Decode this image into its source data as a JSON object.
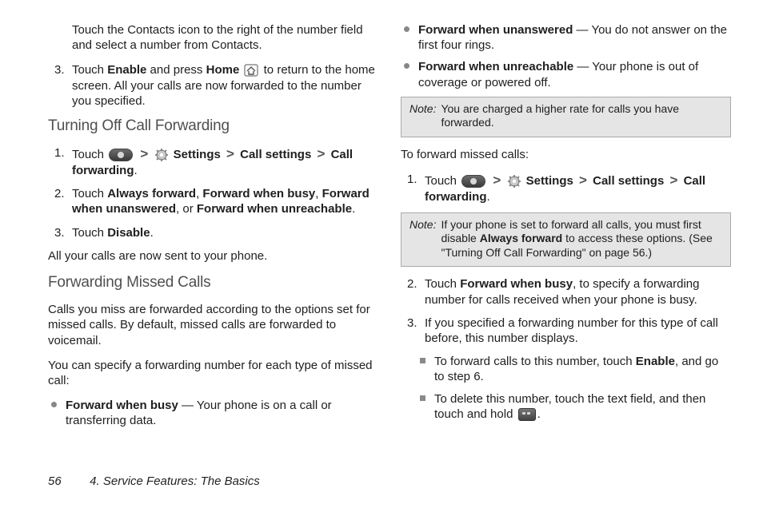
{
  "left": {
    "top_hang": "Touch the Contacts icon to the right of the number field and select a number from Contacts.",
    "step3": {
      "num": "3.",
      "a": "Touch ",
      "enable": "Enable",
      "b": " and press ",
      "home": "Home",
      "c": " to return to the home screen. All your calls are now forwarded to the number you specified."
    },
    "h_off": "Turning Off Call Forwarding",
    "off1": {
      "num": "1.",
      "a": "Touch ",
      "settings": "Settings",
      "callset": "Call settings",
      "callfwd": "Call forwarding",
      "dot": "."
    },
    "off2": {
      "num": "2.",
      "a": "Touch ",
      "af": "Always forward",
      "c1": ", ",
      "fb": "Forward when busy",
      "c2": ", ",
      "fu": "Forward when unanswered",
      "c3": ", or ",
      "fr": "Forward when unreachable",
      "dot": "."
    },
    "off3": {
      "num": "3.",
      "a": "Touch ",
      "dis": "Disable",
      "dot": "."
    },
    "sent": "All your calls are now sent to your phone.",
    "h_fwd": "Forwarding Missed Calls",
    "fwd_p1": "Calls you miss are forwarded according to the options set for missed calls. By default, missed calls are forwarded to voicemail.",
    "fwd_p2": "You can specify a forwarding number for each type of missed call:",
    "bullet_busy": {
      "t": "Forward when busy",
      "d": " — Your phone is on a call or transferring data."
    }
  },
  "right": {
    "bullet_unans": {
      "t": "Forward when unanswered",
      "d": " — You do not answer on the first four rings."
    },
    "bullet_unreach": {
      "t": "Forward when unreachable",
      "d": " — Your phone is out of coverage or powered off."
    },
    "note1": {
      "label": "Note:",
      "text": "You are charged a higher rate for calls you have forwarded."
    },
    "to_fwd": "To forward missed calls:",
    "step1": {
      "num": "1.",
      "a": "Touch ",
      "settings": "Settings",
      "callset": "Call settings",
      "callfwd": "Call forwarding",
      "dot": "."
    },
    "note2": {
      "label": "Note:",
      "a": "If your phone is set to forward all calls, you must first disable ",
      "af": "Always forward",
      "b": " to access these options. (See \"Turning Off Call Forwarding\" on page 56.)"
    },
    "step2": {
      "num": "2.",
      "a": "Touch ",
      "fb": "Forward when busy",
      "b": ", to specify a forwarding number for calls received when your phone is busy."
    },
    "step3r": {
      "num": "3.",
      "a": "If you specified a forwarding number for this type of call before, this number displays."
    },
    "sub_a": {
      "a": "To forward calls to this number, touch ",
      "en": "Enable",
      "b": ", and go to step 6."
    },
    "sub_b": {
      "a": "To delete this number, touch the text field, and then touch and hold ",
      "b": "."
    }
  },
  "footer": {
    "page": "56",
    "title": "4. Service Features: The Basics"
  },
  "gt": ">"
}
